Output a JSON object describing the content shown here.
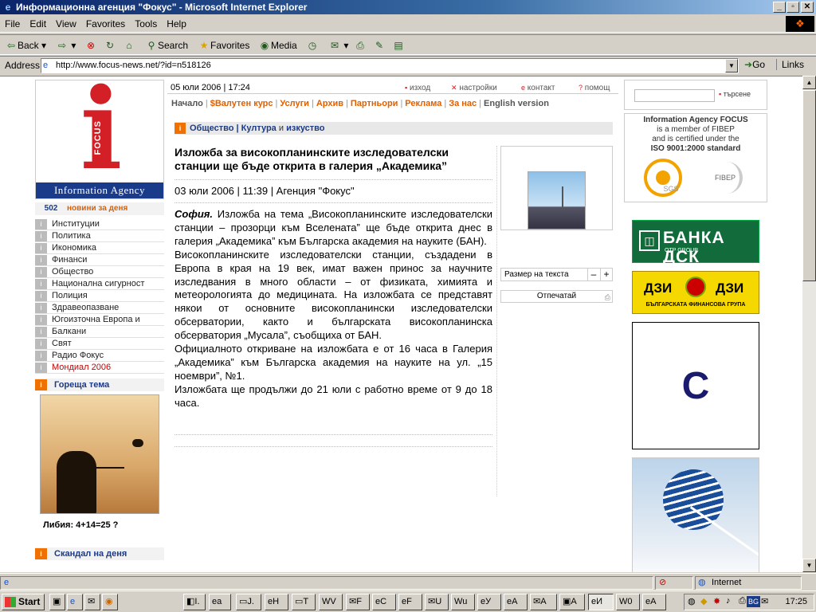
{
  "window": {
    "title": "Информационна агенция \"Фокус\" - Microsoft Internet Explorer",
    "minimize": "_",
    "maximize": "▫",
    "close": "✕"
  },
  "menu": [
    "File",
    "Edit",
    "View",
    "Favorites",
    "Tools",
    "Help"
  ],
  "toolbar": {
    "back": "Back",
    "search": "Search",
    "favorites": "Favorites",
    "media": "Media"
  },
  "address": {
    "label": "Address",
    "url": "http://www.focus-news.net/?id=n518126",
    "go": "Go",
    "links": "Links"
  },
  "logo": {
    "letter": "i",
    "vertical": "FOCUS",
    "agency": "Information Agency"
  },
  "news_count": {
    "count": "502",
    "label": "новини за деня"
  },
  "nav_items": [
    "Институции",
    "Политика",
    "Икономика",
    "Финанси",
    "Общество",
    "Национална сигурност",
    "Полиция",
    "Здравеопазване",
    "Югоизточна Европа и",
    "Балкани",
    "Свят",
    "Радио Фокус",
    "Мондиал 2006"
  ],
  "nav_marker": "i",
  "hot_topic": {
    "heading": "Гореща тема",
    "caption": "Либия: 4+14=25 ?"
  },
  "scandal": {
    "heading": "Скандал на деня"
  },
  "topbar": {
    "date": "05 юли 2006 | 17:24",
    "exit": "изход",
    "settings": "настройки",
    "contact": "контакт",
    "help": "помощ"
  },
  "mainnav": {
    "home": "Начало",
    "currency": "$Валутен курс",
    "services": "Услуги",
    "archive": "Архив",
    "partners": "Партньори",
    "ads": "Реклама",
    "about": "За нас",
    "english": "English version"
  },
  "category": {
    "part1": "Общество",
    "sep": "|",
    "part2": "Култура",
    "and": "и",
    "part3": "изкуство"
  },
  "article": {
    "title": "Изложба за високопланинските изследователски станции ще бъде открита в галерия „Академика”",
    "meta": "03 юли 2006 | 11:39 | Агенция \"Фокус\"",
    "city": "София.",
    "p1": "Изложба на тема „Високопланинските изследователски станции – прозорци към Вселената” ще бъде открита днес в галерия „Академика” към Българска академия на науките (БАН).",
    "p2": "Високопланинските изследователски станции, създадени в Европа в края на 19 век, имат важен принос за научните изследвания в много области – от физиката, химията и метеорологията до медицината. На изложбата се представят някои от основните високопланински изследователски обсерватории, както и българската високопланинска обсерватория „Мусала”, съобщиха от БАН.",
    "p3": "Официалното откриване на изложбата е от 16 часа в Галерия „Академика” към Българска академия на науките на ул. „15 ноември”, №1.",
    "p4": "Изложбата ще продължи до 21 юли с работно време от 9 до 18 часа."
  },
  "tools": {
    "text_size": "Размер на текста",
    "minus": "–",
    "plus": "+",
    "print": "Отпечатай"
  },
  "right": {
    "search": "търсене",
    "iaf_line1": "Information Agency FOCUS",
    "iaf_line2": "is a member of FIBEP",
    "iaf_line3": "and is certified under the",
    "iaf_line4": "ISO 9001:2000 standard",
    "sgs": "SGS",
    "fibep": "FIBEP",
    "dsk_name": "БАНКА ДСК",
    "dsk_sub": "OTP GROUP",
    "dzi_left": "ДЗИ",
    "dzi_right": "ДЗИ",
    "dzi_sub": "БЪЛГАРСКАТА ФИНАНСОВА ГРУПА",
    "c_letter": "C"
  },
  "status": {
    "zone": "Internet"
  },
  "taskbar": {
    "start": "Start",
    "tasks": [
      "I.",
      "a",
      "J.",
      "H",
      "T",
      "V",
      "F",
      "C",
      "F",
      "U",
      "u",
      "У",
      "A",
      "A",
      "A",
      "И",
      "0",
      "A"
    ],
    "lang": "BG",
    "clock": "17:25"
  }
}
